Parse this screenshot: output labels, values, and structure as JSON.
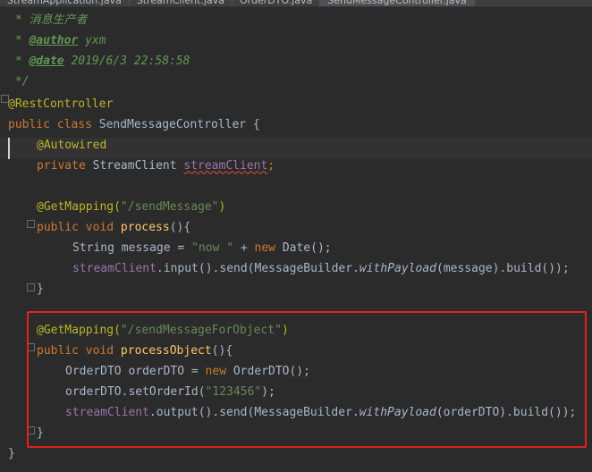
{
  "tabs": [
    {
      "label": "StreamApplication.java"
    },
    {
      "label": "StreamClient.java"
    },
    {
      "label": "OrderDTO.java"
    },
    {
      "label": "SendMessageController.java"
    }
  ],
  "code": {
    "l1_star": " * ",
    "l1_text": "消息生产者",
    "l2_star": " * ",
    "l2_tag": "@author",
    "l2_val": " yxm",
    "l3_star": " * ",
    "l3_tag": "@date",
    "l3_val": " 2019/6/3 22:58:58",
    "l4": " */",
    "l5": "@RestController",
    "l6_kw": "public class ",
    "l6_name": "SendMessageController {",
    "l7": "@Autowired",
    "l8_kw": "private ",
    "l8_type": "StreamClient ",
    "l8_field": "streamClient",
    "l8_end": ";",
    "l10_anno": "@GetMapping(",
    "l10_str": "\"/sendMessage\"",
    "l10_end": ")",
    "l11_kw": "public void ",
    "l11_method": "process",
    "l11_end": "(){",
    "l12_type": "String message = ",
    "l12_str": "\"now \"",
    "l12_mid": " + ",
    "l12_kw": "new ",
    "l12_end": "Date();",
    "l13_field": "streamClient",
    "l13_mid": ".input().send(MessageBuilder.",
    "l13_static": "withPayload",
    "l13_end": "(message).build());",
    "l14": "}",
    "l16_anno": "@GetMapping(",
    "l16_str": "\"/sendMessageForObject\"",
    "l16_end": ")",
    "l17_kw": "public void ",
    "l17_method": "processObject",
    "l17_end": "(){",
    "l18_a": "OrderDTO orderDTO = ",
    "l18_kw": "new ",
    "l18_b": "OrderDTO();",
    "l19_a": "orderDTO.setOrderId(",
    "l19_str": "\"123456\"",
    "l19_end": ");",
    "l20_field": "streamClient",
    "l20_mid": ".output().send(MessageBuilder.",
    "l20_static": "withPayload",
    "l20_end": "(orderDTO).build());",
    "l21": "}",
    "l22": "}"
  }
}
